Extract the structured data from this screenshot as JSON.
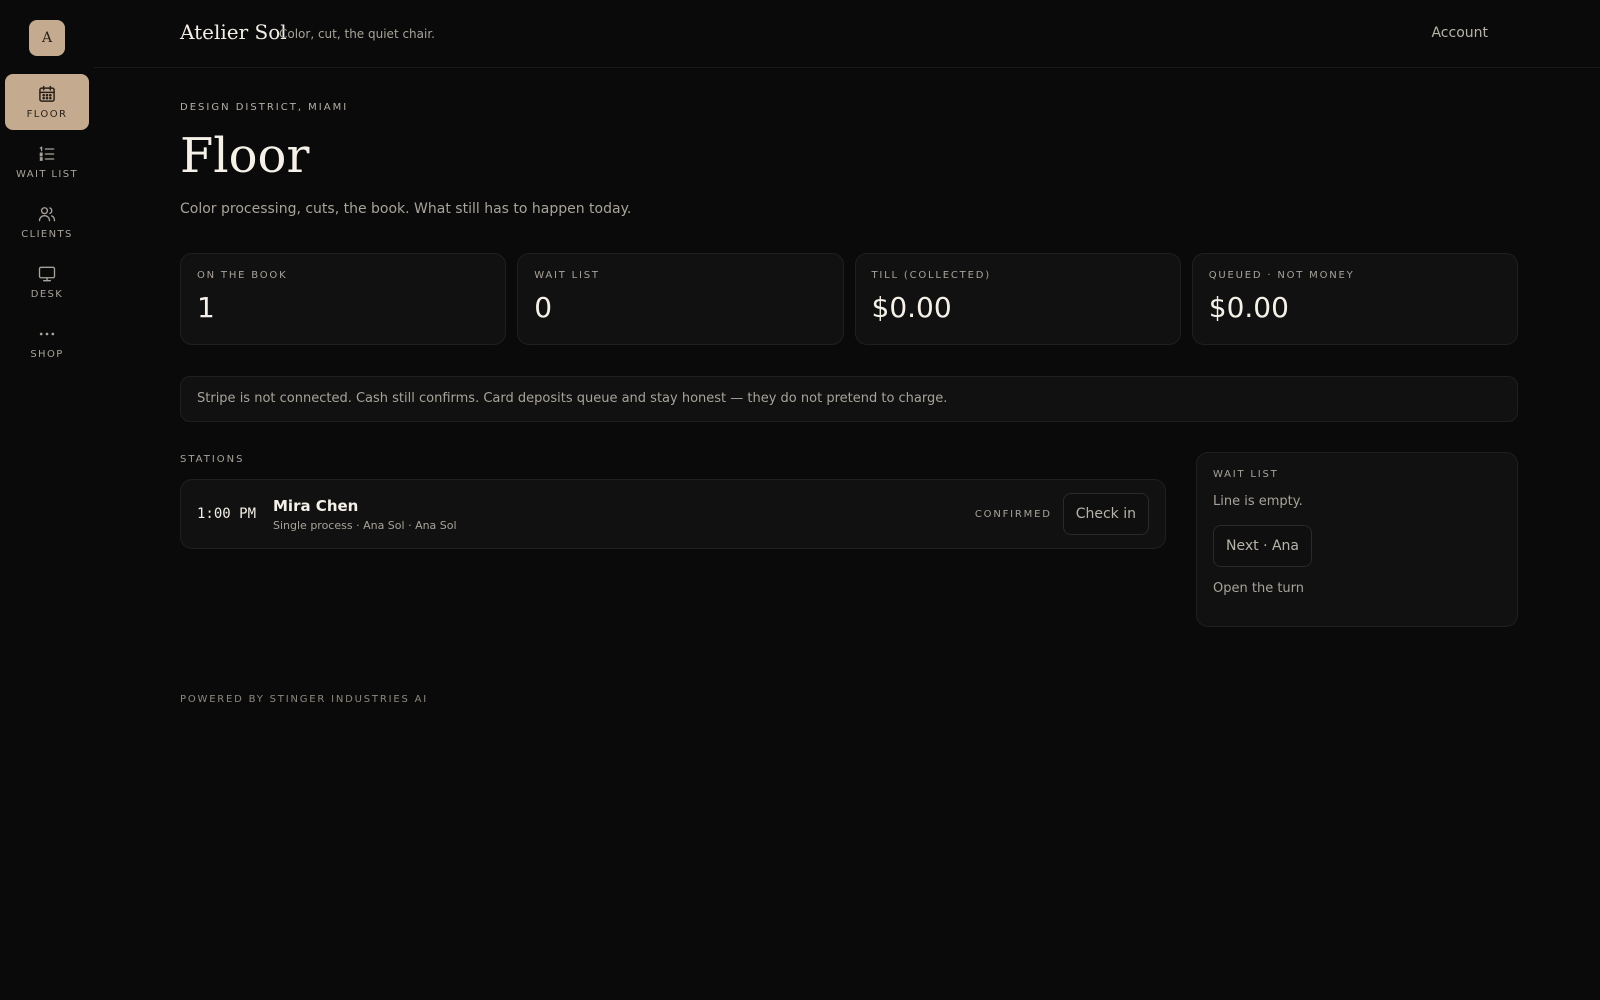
{
  "app": {
    "avatar_letter": "A",
    "brand": "Atelier Sol",
    "tagline": "Color, cut, the quiet chair.",
    "account": "Account"
  },
  "sidebar": {
    "items": [
      {
        "label": "FLOOR",
        "icon": "calendar-icon",
        "active": true
      },
      {
        "label": "WAIT LIST",
        "icon": "list-icon",
        "active": false
      },
      {
        "label": "CLIENTS",
        "icon": "users-icon",
        "active": false
      },
      {
        "label": "DESK",
        "icon": "monitor-icon",
        "active": false
      },
      {
        "label": "SHOP",
        "icon": "more-icon",
        "active": false
      }
    ]
  },
  "page": {
    "eyebrow": "DESIGN DISTRICT, MIAMI",
    "title": "Floor",
    "subtitle": "Color processing, cuts, the book. What still has to happen today."
  },
  "stats": [
    {
      "label": "ON THE BOOK",
      "value": "1"
    },
    {
      "label": "WAIT LIST",
      "value": "0"
    },
    {
      "label": "TILL (COLLECTED)",
      "value": "$0.00"
    },
    {
      "label": "QUEUED · NOT MONEY",
      "value": "$0.00"
    }
  ],
  "notice": "Stripe is not connected. Cash still confirms. Card deposits queue and stay honest — they do not pretend to charge.",
  "stations": {
    "label": "STATIONS",
    "rows": [
      {
        "time": "1:00 PM",
        "name": "Mira Chen",
        "detail": "Single process · Ana Sol · Ana Sol",
        "status": "CONFIRMED",
        "action": "Check in"
      }
    ]
  },
  "waitlist": {
    "label": "WAIT LIST",
    "empty": "Line is empty.",
    "next_button": "Next · Ana",
    "open_turn": "Open the turn"
  },
  "footer": "POWERED BY STINGER INDUSTRIES AI",
  "colors": {
    "background": "#0a0a0a",
    "accent": "#c4ab90",
    "card": "#111111"
  }
}
